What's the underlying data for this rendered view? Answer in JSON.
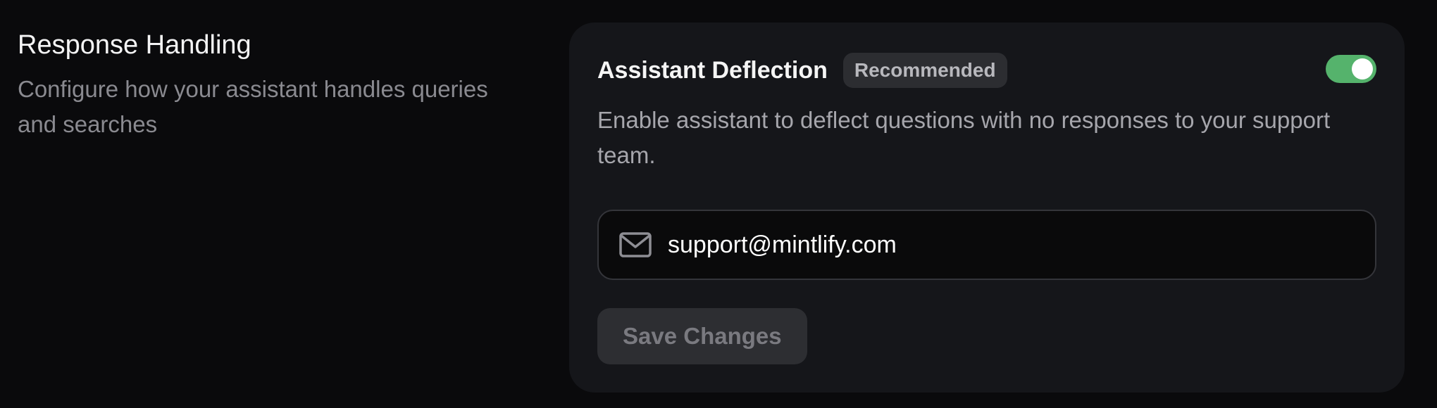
{
  "section": {
    "title": "Response Handling",
    "description": "Configure how your assistant handles queries and searches"
  },
  "deflection": {
    "title": "Assistant Deflection",
    "badge": "Recommended",
    "enabled": true,
    "description": "Enable assistant to deflect questions with no responses to your support team.",
    "email_icon": "mail-icon",
    "email_value": "support@mintlify.com",
    "save_label": "Save Changes"
  },
  "colors": {
    "toggle_on": "#55b36c",
    "card_bg": "#15161a",
    "page_bg": "#0a0a0c"
  }
}
